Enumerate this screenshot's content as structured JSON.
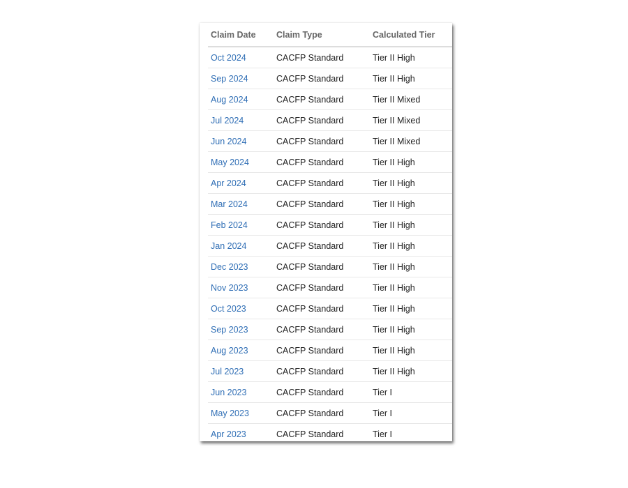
{
  "table": {
    "headers": [
      "Claim Date",
      "Claim Type",
      "Calculated Tier"
    ],
    "rows": [
      [
        "Oct 2024",
        "CACFP Standard",
        "Tier II High"
      ],
      [
        "Sep 2024",
        "CACFP Standard",
        "Tier II High"
      ],
      [
        "Aug 2024",
        "CACFP Standard",
        "Tier II Mixed"
      ],
      [
        "Jul 2024",
        "CACFP Standard",
        "Tier II Mixed"
      ],
      [
        "Jun 2024",
        "CACFP Standard",
        "Tier II Mixed"
      ],
      [
        "May 2024",
        "CACFP Standard",
        "Tier II High"
      ],
      [
        "Apr 2024",
        "CACFP Standard",
        "Tier II High"
      ],
      [
        "Mar 2024",
        "CACFP Standard",
        "Tier II High"
      ],
      [
        "Feb 2024",
        "CACFP Standard",
        "Tier II High"
      ],
      [
        "Jan 2024",
        "CACFP Standard",
        "Tier II High"
      ],
      [
        "Dec 2023",
        "CACFP Standard",
        "Tier II High"
      ],
      [
        "Nov 2023",
        "CACFP Standard",
        "Tier II High"
      ],
      [
        "Oct 2023",
        "CACFP Standard",
        "Tier II High"
      ],
      [
        "Sep 2023",
        "CACFP Standard",
        "Tier II High"
      ],
      [
        "Aug 2023",
        "CACFP Standard",
        "Tier II High"
      ],
      [
        "Jul 2023",
        "CACFP Standard",
        "Tier II High"
      ],
      [
        "Jun 2023",
        "CACFP Standard",
        "Tier I"
      ],
      [
        "May 2023",
        "CACFP Standard",
        "Tier I"
      ],
      [
        "Apr 2023",
        "CACFP Standard",
        "Tier I"
      ]
    ]
  },
  "colors": {
    "link": "#2f6eb5",
    "header_text": "#666666"
  }
}
